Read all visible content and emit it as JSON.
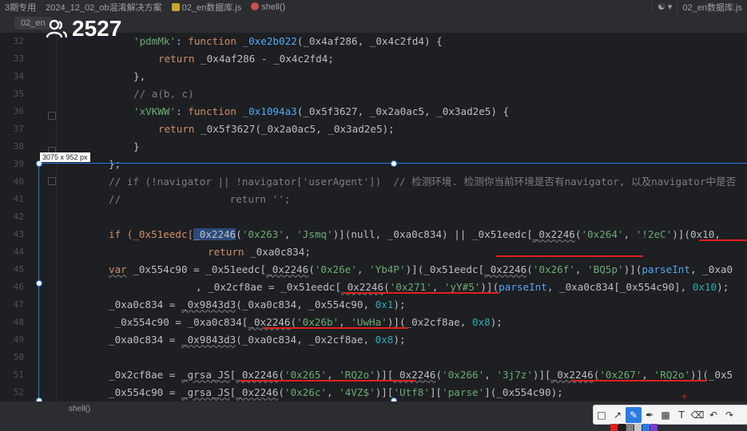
{
  "topbar": {
    "project": "3期专用",
    "path": "2024_12_02_ob混淆解决方案",
    "file": "02_en数据库.js",
    "function": "shell()",
    "right_file": "02_en数据库.js"
  },
  "tab": {
    "label": "02_en"
  },
  "count": {
    "value": "2527"
  },
  "selection_size": "3075 x 952  px",
  "line_numbers": [
    "32",
    "33",
    "34",
    "35",
    "36",
    "37",
    "38",
    "39",
    "40",
    "41",
    "42",
    "43",
    "44",
    "45",
    "46",
    "47",
    "48",
    "49",
    "50",
    "51",
    "52"
  ],
  "code": {
    "l32": {
      "key": "'pdmMk'",
      "colon": ": ",
      "kw": "function",
      "fn": "_0xe2b022",
      "args": "(_0x4af286, _0x4c2fd4) {"
    },
    "l33": {
      "kw": "return",
      "rest": " _0x4af286 - _0x4c2fd4;"
    },
    "l34": "},",
    "l35": "// a(b, c)",
    "l36": {
      "key": "'xVKWW'",
      "colon": ": ",
      "kw": "function",
      "fn": "_0x1094a3",
      "args": "(_0x5f3627, _0x2a0ac5, _0x3ad2e5) {"
    },
    "l37": {
      "kw": "return",
      "rest": " _0x5f3627(_0x2a0ac5, _0x3ad2e5);"
    },
    "l38": "}",
    "l39": "};",
    "l40": "// if (!navigator || !navigator['userAgent'])  // 检测环境. 检测你当前环境是否有navigator, 以及navigator中是否",
    "l41": "//                  return '';",
    "l43": {
      "a": "if (_0x51eedc[",
      "b": "_0x2246",
      "c": "(",
      "s1": "'0x263'",
      "c2": ", ",
      "s2": "'Jsmq'",
      "c3": ")](null, _0xa0c834) || _0x51eedc[",
      "d": "_0x2246",
      "e": "(",
      "s3": "'0x264'",
      "c4": ", ",
      "s4": "'!2eC'",
      "f": ")](0x10, _"
    },
    "l44": {
      "kw": "return",
      "rest": " _0xa0c834;"
    },
    "l45": {
      "kw": "var",
      "a": " _0x554c90 = _0x51eedc[",
      "b": "_0x2246",
      "c": "(",
      "s1": "'0x26e'",
      "c2": ", ",
      "s2": "'Yb4P'",
      "d": ")](_0x51eedc[",
      "e": "_0x2246",
      "f": "(",
      "s3": "'0x26f'",
      "c3": ", ",
      "s4": "'BQ5p'",
      "g": ")](",
      "fn": "parseInt",
      "h": ", _0xa0"
    },
    "l46": {
      "a": ", _0x2cf8ae = _0x51eedc[",
      "b": "_0x2246",
      "c": "(",
      "s1": "'0x271'",
      "c2": ", ",
      "s2": "'yY#5'",
      "d": ")](",
      "fn": "parseInt",
      "e": ", _0xa0c834[_0x554c90], ",
      "n": "0x10",
      "f": ");"
    },
    "l47": {
      "a": "_0xa0c834 = ",
      "b": "_0x9843d3",
      "c": "(_0xa0c834, _0x554c90, ",
      "n": "0x1",
      "d": ");"
    },
    "l48": {
      "a": " _0x554c90 = _0xa0c834[",
      "b": "_0x2246",
      "c": "(",
      "s1": "'0x26b'",
      "c2": ", ",
      "s2": "'UwHa'",
      "d": ")](_0x2cf8ae, ",
      "n": "0x8",
      "e": ");"
    },
    "l49": {
      "a": "_0xa0c834 = ",
      "b": "_0x9843d3",
      "c": "(_0xa0c834, _0x2cf8ae, ",
      "n": "0x8",
      "d": ");"
    },
    "l51": {
      "a": "_0x2cf8ae = ",
      "b": "_grsa_JS",
      "c": "[",
      "d1": "_0x2246",
      "e1": "(",
      "s1": "'0x265'",
      "c1": ", ",
      "s2": "'RQ2o'",
      "f1": ")][",
      "d2": "_0x2246",
      "e2": "(",
      "s3": "'0x266'",
      "c2": ", ",
      "s4": "'3j7z'",
      "f2": ")][",
      "d3": "_0x2246",
      "e3": "(",
      "s5": "'0x267'",
      "c3": ", ",
      "s6": "'RQ2o'",
      "f3": ")](_0x5"
    },
    "l52": {
      "a": "_0x554c90 = ",
      "b": "_grsa_JS",
      "c": "[",
      "d": "_0x2246",
      "e": "(",
      "s1": "'0x26c'",
      "c2": ", ",
      "s2": "'4VZ$'",
      "f": ")][",
      "s3": "'Utf8'",
      "g": "][",
      "s4": "'parse'",
      "h": "](_0x554c90);"
    }
  },
  "bottom": {
    "shell": "shell()"
  },
  "palette": [
    "#e0201e",
    "#1e1e1e",
    "#7f7f7f",
    "#c8c8c8",
    "#2a7be4",
    "#7a3bd1"
  ],
  "accent": "#2a7be4"
}
